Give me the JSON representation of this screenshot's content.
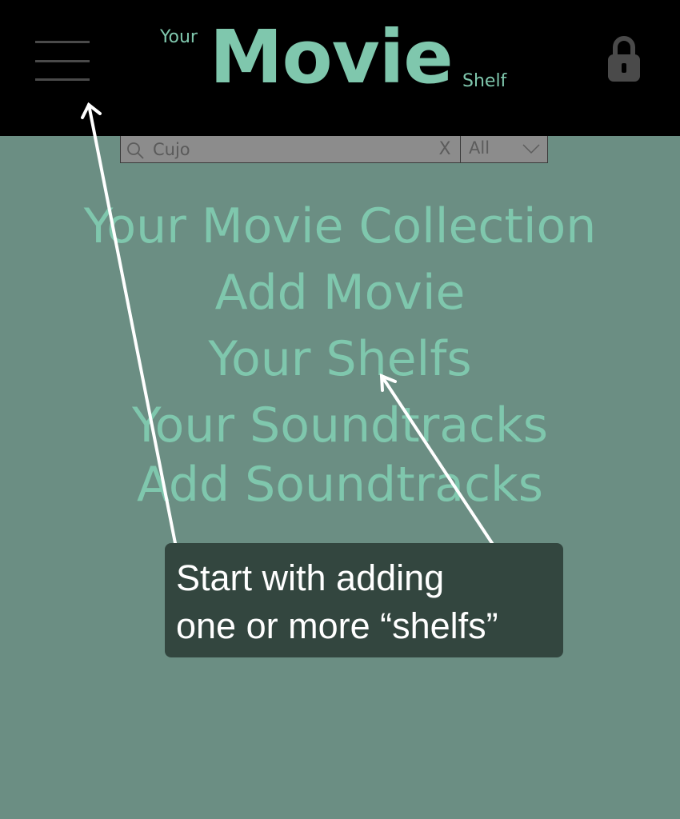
{
  "header": {
    "logo_your": "Your",
    "logo_movie": "Movie",
    "logo_shelf": "Shelf",
    "menu_icon": "hamburger-menu-icon",
    "lock_icon": "lock-icon"
  },
  "search": {
    "value": "Cujo",
    "clear_label": "X",
    "filter_value": "All",
    "search_icon": "search-icon",
    "chevron_icon": "chevron-down-icon"
  },
  "menu": {
    "items": [
      {
        "label": "Your Movie Collection"
      },
      {
        "label": "Add Movie"
      },
      {
        "label": "Your Shelfs"
      },
      {
        "label": "Your Soundtracks"
      },
      {
        "label": "Add Soundtracks"
      }
    ]
  },
  "tooltip": {
    "line1": "Start with adding",
    "line2": "one or more “shelfs”"
  },
  "colors": {
    "background": "#6b8e83",
    "topbar": "#000000",
    "accent": "#7fc7ad",
    "tooltip_bg": "#33463f"
  }
}
